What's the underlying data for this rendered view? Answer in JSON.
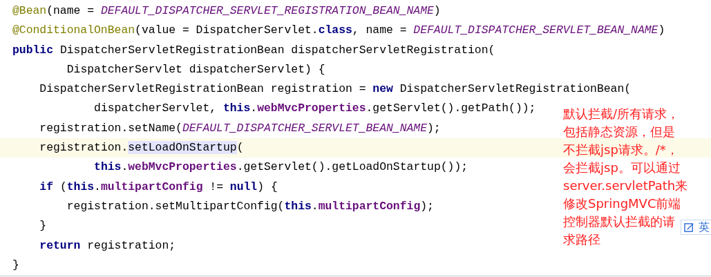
{
  "editor": {
    "lines": [
      {
        "current": false,
        "tokens": [
          {
            "kind": "annotation",
            "text": "@Bean"
          },
          {
            "kind": "plain",
            "text": "(name = "
          },
          {
            "kind": "constant",
            "text": "DEFAULT_DISPATCHER_SERVLET_REGISTRATION_BEAN_NAME"
          },
          {
            "kind": "plain",
            "text": ")"
          }
        ]
      },
      {
        "current": false,
        "tokens": [
          {
            "kind": "annotation",
            "text": "@ConditionalOnBean"
          },
          {
            "kind": "plain",
            "text": "(value = DispatcherServlet."
          },
          {
            "kind": "keyword",
            "text": "class"
          },
          {
            "kind": "plain",
            "text": ", name = "
          },
          {
            "kind": "constant",
            "text": "DEFAULT_DISPATCHER_SERVLET_BEAN_NAME"
          },
          {
            "kind": "plain",
            "text": ")"
          }
        ]
      },
      {
        "current": false,
        "tokens": [
          {
            "kind": "keyword",
            "text": "public"
          },
          {
            "kind": "plain",
            "text": " DispatcherServletRegistrationBean dispatcherServletRegistration("
          }
        ]
      },
      {
        "current": false,
        "tokens": [
          {
            "kind": "plain",
            "text": "        DispatcherServlet dispatcherServlet) {"
          }
        ]
      },
      {
        "current": false,
        "tokens": [
          {
            "kind": "plain",
            "text": "    DispatcherServletRegistrationBean registration = "
          },
          {
            "kind": "keyword",
            "text": "new"
          },
          {
            "kind": "plain",
            "text": " DispatcherServletRegistrationBean("
          }
        ]
      },
      {
        "current": false,
        "tokens": [
          {
            "kind": "plain",
            "text": "            dispatcherServlet, "
          },
          {
            "kind": "keyword",
            "text": "this"
          },
          {
            "kind": "plain",
            "text": "."
          },
          {
            "kind": "field",
            "text": "webMvcProperties"
          },
          {
            "kind": "plain",
            "text": ".getServlet().getPath());"
          }
        ]
      },
      {
        "current": false,
        "tokens": [
          {
            "kind": "plain",
            "text": "    registration.setName("
          },
          {
            "kind": "constant",
            "text": "DEFAULT_DISPATCHER_SERVLET_BEAN_NAME"
          },
          {
            "kind": "plain",
            "text": ");"
          }
        ]
      },
      {
        "current": true,
        "tokens": [
          {
            "kind": "plain",
            "text": "    registration."
          },
          {
            "kind": "usage",
            "text": "setLoadOnStartup"
          },
          {
            "kind": "plain",
            "text": "("
          }
        ]
      },
      {
        "current": false,
        "tokens": [
          {
            "kind": "keyword",
            "text": "            this"
          },
          {
            "kind": "plain",
            "text": "."
          },
          {
            "kind": "field",
            "text": "webMvcProperties"
          },
          {
            "kind": "plain",
            "text": ".getServlet().getLoadOnStartup());"
          }
        ]
      },
      {
        "current": false,
        "tokens": [
          {
            "kind": "keyword",
            "text": "    if"
          },
          {
            "kind": "plain",
            "text": " ("
          },
          {
            "kind": "keyword",
            "text": "this"
          },
          {
            "kind": "plain",
            "text": "."
          },
          {
            "kind": "field",
            "text": "multipartConfig"
          },
          {
            "kind": "plain",
            "text": " != "
          },
          {
            "kind": "keyword",
            "text": "null"
          },
          {
            "kind": "plain",
            "text": ") {"
          }
        ]
      },
      {
        "current": false,
        "tokens": [
          {
            "kind": "plain",
            "text": "        registration.setMultipartConfig("
          },
          {
            "kind": "keyword",
            "text": "this"
          },
          {
            "kind": "plain",
            "text": "."
          },
          {
            "kind": "field",
            "text": "multipartConfig"
          },
          {
            "kind": "plain",
            "text": ");"
          }
        ]
      },
      {
        "current": false,
        "tokens": [
          {
            "kind": "plain",
            "text": "    }"
          }
        ]
      },
      {
        "current": false,
        "tokens": [
          {
            "kind": "keyword",
            "text": "    return"
          },
          {
            "kind": "plain",
            "text": " registration;"
          }
        ]
      },
      {
        "current": false,
        "tokens": [
          {
            "kind": "plain",
            "text": "}"
          }
        ]
      }
    ]
  },
  "note": {
    "lines": [
      "默认拦截/所有请求，",
      "包括静态资源，但是",
      "不拦截jsp请求。/*，",
      "会拦截jsp。可以通过",
      "server.servletPath来",
      "修改SpringMVC前端",
      "控制器默认拦截的请",
      "求路径"
    ]
  },
  "ime_toolbar": {
    "label": "英"
  }
}
